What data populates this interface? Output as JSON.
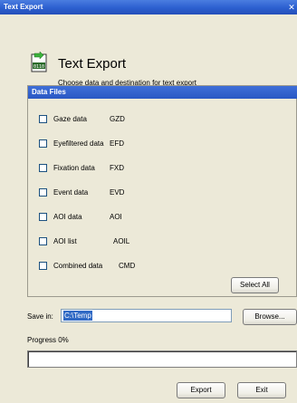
{
  "window": {
    "title": "Text Export",
    "close_glyph": "✕"
  },
  "header": {
    "icon": "text-export-file-icon",
    "title": "Text Export",
    "subtitle": "Choose data and destination for text export"
  },
  "data_files": {
    "title": "Data Files",
    "items": [
      {
        "label": "Gaze data",
        "code": "GZD",
        "checked": false
      },
      {
        "label": "Eyefiltered data",
        "code": "EFD",
        "checked": false
      },
      {
        "label": "Fixation data",
        "code": "FXD",
        "checked": false
      },
      {
        "label": "Event data",
        "code": "EVD",
        "checked": false
      },
      {
        "label": "AOI data",
        "code": "AOI",
        "checked": false
      },
      {
        "label": "AOI list",
        "code": "AOIL",
        "checked": false
      },
      {
        "label": "Combined data",
        "code": "CMD",
        "checked": false
      }
    ],
    "select_all_label": "Select All"
  },
  "save": {
    "label": "Save in:",
    "value": "C:\\Temp",
    "browse_label": "Browse..."
  },
  "progress": {
    "label": "Progress 0%",
    "value": 0
  },
  "footer": {
    "export_label": "Export",
    "exit_label": "Exit"
  }
}
